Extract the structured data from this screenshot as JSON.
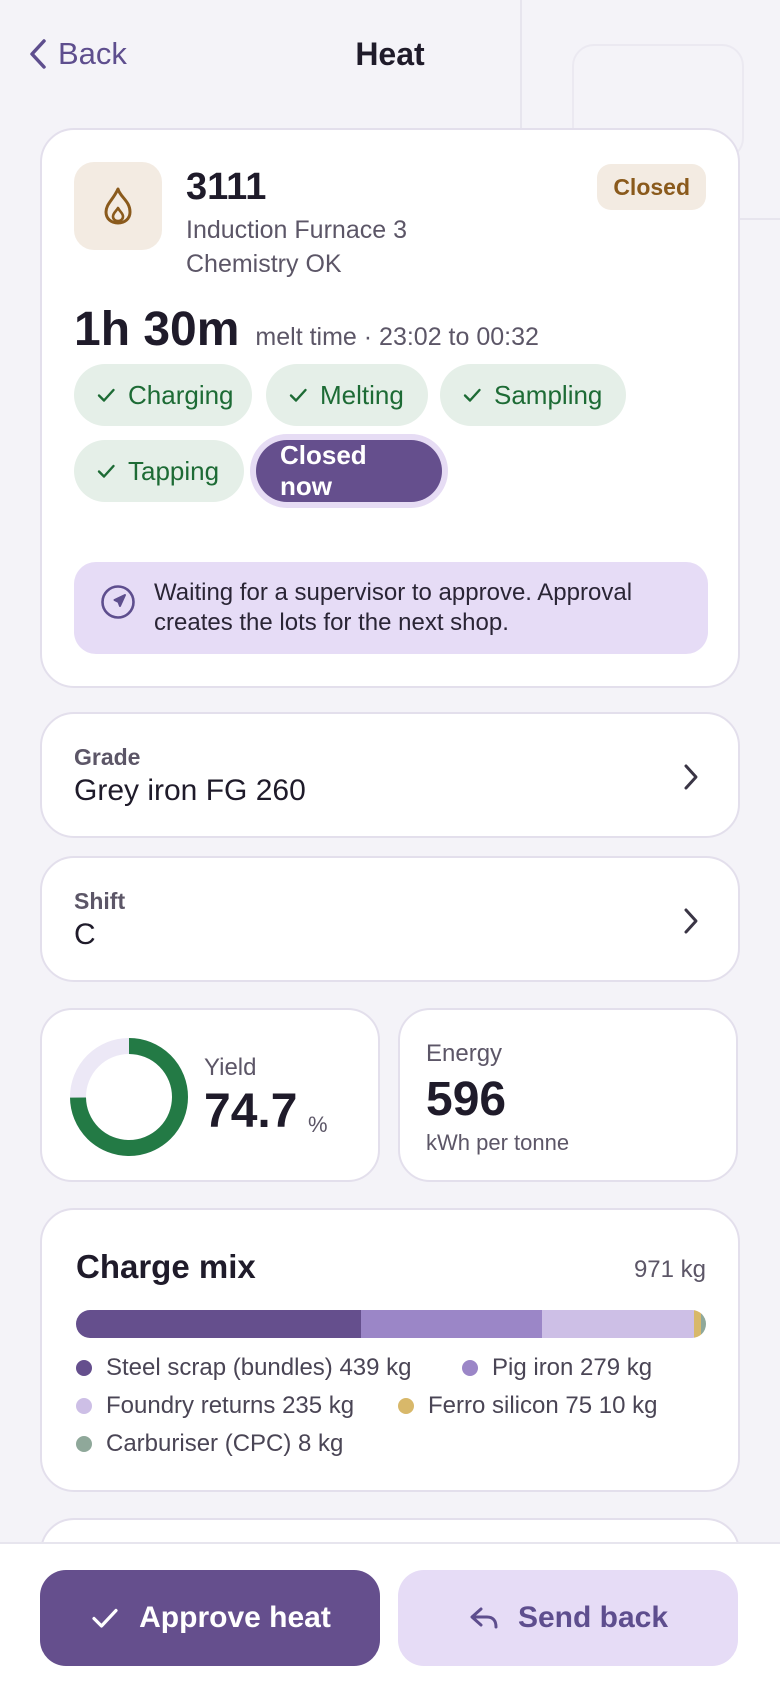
{
  "header": {
    "back_label": "Back",
    "title": "Heat"
  },
  "heat": {
    "id": "3111",
    "furnace": "Induction Furnace 3",
    "chemistry": "Chemistry OK",
    "status": "Closed",
    "duration": "1h 30m",
    "duration_detail": "melt time · 23:02 to 00:32",
    "stages": [
      {
        "label": "Charging",
        "done": true
      },
      {
        "label": "Melting",
        "done": true
      },
      {
        "label": "Sampling",
        "done": true
      },
      {
        "label": "Tapping",
        "done": true
      },
      {
        "label": "Closed now",
        "done": false,
        "current": true
      }
    ],
    "notice": "Waiting for a supervisor to approve. Approval creates the lots for the next shop."
  },
  "grade": {
    "label": "Grade",
    "value": "Grey iron FG 260"
  },
  "shift": {
    "label": "Shift",
    "value": "C"
  },
  "yield": {
    "label": "Yield",
    "value": "74.7",
    "unit": "%",
    "fraction": 0.747
  },
  "energy": {
    "label": "Energy",
    "value": "596",
    "unit": "kWh per tonne"
  },
  "charge_mix": {
    "title": "Charge mix",
    "total": "971 kg",
    "items": [
      {
        "label": "Steel scrap (bundles) 439 kg",
        "kg": 439,
        "color": "#654f8d"
      },
      {
        "label": "Pig iron 279 kg",
        "kg": 279,
        "color": "#9b86c7"
      },
      {
        "label": "Foundry returns 235 kg",
        "kg": 235,
        "color": "#cdbfe6"
      },
      {
        "label": "Ferro silicon 75 10 kg",
        "kg": 10,
        "color": "#d8b86a"
      },
      {
        "label": "Carburiser (CPC) 8 kg",
        "kg": 8,
        "color": "#8fa89a"
      }
    ]
  },
  "actions": {
    "approve_label": "Approve heat",
    "send_back_label": "Send back"
  },
  "colors": {
    "accent": "#654f8d",
    "success": "#1d6b35",
    "yield_ring": "#237a45",
    "ring_track": "#ece8f6"
  }
}
